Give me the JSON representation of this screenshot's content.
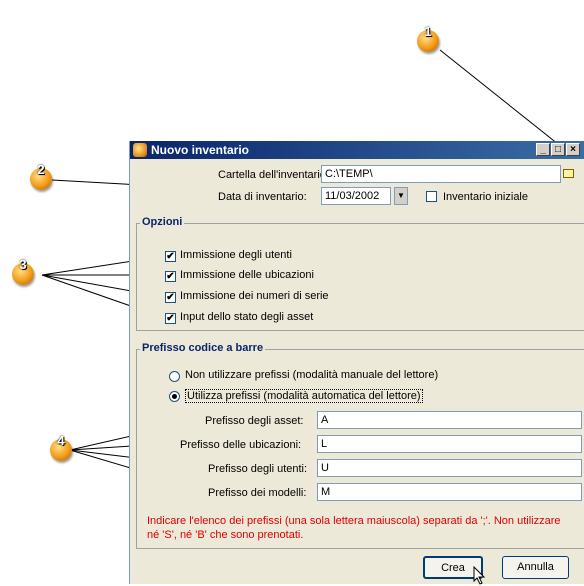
{
  "window": {
    "title": "Nuovo inventario"
  },
  "fields": {
    "folder_label": "Cartella dell'inventario:",
    "folder_value": "C:\\TEMP\\",
    "date_label": "Data di inventario:",
    "date_value": "11/03/2002",
    "initial_label": "Inventario iniziale"
  },
  "options": {
    "title": "Opzioni",
    "items": [
      {
        "label": "Immissione degli utenti",
        "checked": true
      },
      {
        "label": "Immissione delle ubicazioni",
        "checked": true
      },
      {
        "label": "Immissione dei numeri di serie",
        "checked": true
      },
      {
        "label": "Input dello stato degli asset",
        "checked": true
      }
    ]
  },
  "barcode": {
    "title": "Prefisso codice a barre",
    "radio_none": "Non utilizzare prefissi (modalità manuale del lettore)",
    "radio_use": "Utilizza prefissi (modalità automatica del lettore)",
    "prefixes": [
      {
        "label": "Prefisso degli asset:",
        "value": "A"
      },
      {
        "label": "Prefisso delle ubicazioni:",
        "value": "L"
      },
      {
        "label": "Prefisso degli utenti:",
        "value": "U"
      },
      {
        "label": "Prefisso dei modelli:",
        "value": "M"
      }
    ],
    "note": "Indicare l'elenco dei prefissi (una sola lettera maiuscola) separati da ';'. Non utilizzare né 'S', né 'B' che sono prenotati."
  },
  "buttons": {
    "create": "Crea",
    "cancel": "Annulla"
  },
  "callouts": [
    "1",
    "2",
    "3",
    "4"
  ]
}
